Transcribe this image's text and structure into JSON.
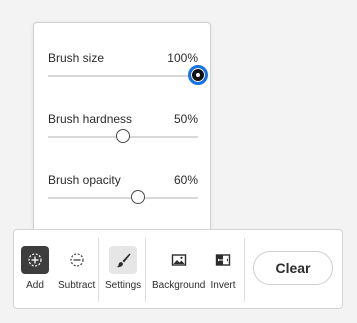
{
  "popover": {
    "sliders": [
      {
        "label": "Brush size",
        "value_text": "100%",
        "value": 1.0
      },
      {
        "label": "Brush hardness",
        "value_text": "50%",
        "value": 0.5
      },
      {
        "label": "Brush opacity",
        "value_text": "60%",
        "value": 0.6
      }
    ]
  },
  "toolbar": {
    "tools": [
      {
        "label": "Add",
        "icon": "add-circle-icon"
      },
      {
        "label": "Subtract",
        "icon": "subtract-circle-icon"
      },
      {
        "label": "Settings",
        "icon": "brush-icon"
      },
      {
        "label": "Background",
        "icon": "image-icon"
      },
      {
        "label": "Invert",
        "icon": "invert-icon"
      }
    ],
    "clear_label": "Clear"
  },
  "colors": {
    "accent": "#1473e6",
    "dark_tool": "#3d3d3d",
    "active_tool": "#e6e6e6"
  }
}
